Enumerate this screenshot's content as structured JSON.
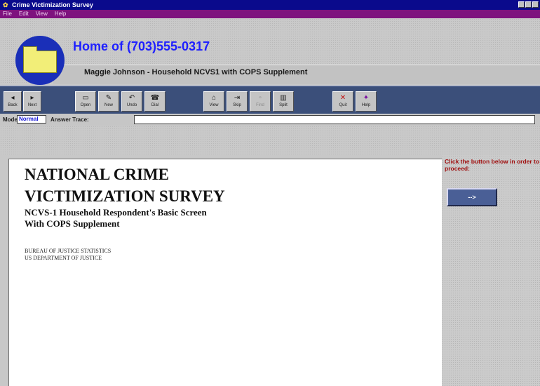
{
  "window": {
    "title": "Crime Victimization Survey"
  },
  "menu": [
    "File",
    "Edit",
    "View",
    "Help"
  ],
  "header": {
    "home_title": "Home of (703)555-0317",
    "subtitle": "Maggie Johnson -  Household NCVS1 with COPS Supplement"
  },
  "toolbar": {
    "buttons": [
      {
        "label": "Back",
        "icon": "back-arrow-icon",
        "glyph": "◂"
      },
      {
        "label": "Next",
        "icon": "next-arrow-icon",
        "glyph": "▸"
      },
      {
        "label": "Open",
        "icon": "open-folder-icon",
        "glyph": "▭"
      },
      {
        "label": "New",
        "icon": "new-case-icon",
        "glyph": "✎"
      },
      {
        "label": "Undo",
        "icon": "undo-icon",
        "glyph": "↶"
      },
      {
        "label": "Dial",
        "icon": "phone-icon",
        "glyph": "☎"
      },
      {
        "label": "View",
        "icon": "house-icon",
        "glyph": "⌂"
      },
      {
        "label": "Skip",
        "icon": "skip-icon",
        "glyph": "⇥"
      },
      {
        "label": "Find",
        "icon": "disabled-icon",
        "glyph": "▫"
      },
      {
        "label": "Split",
        "icon": "split-icon",
        "glyph": "▥"
      },
      {
        "label": "Quit",
        "icon": "quit-x-icon",
        "glyph": "✕"
      },
      {
        "label": "Help",
        "icon": "help-icon",
        "glyph": "✦"
      }
    ]
  },
  "modebar": {
    "mode_label": "Mode:",
    "mode_value": "Normal",
    "trace_label": "Answer Trace:",
    "trace_value": ""
  },
  "document": {
    "title_line1": "NATIONAL CRIME",
    "title_line2": "VICTIMIZATION SURVEY",
    "sub_line1": "NCVS-1 Household Respondent's Basic Screen",
    "sub_line2": "With COPS Supplement",
    "agency_line1": "BUREAU OF JUSTICE STATISTICS",
    "agency_line2": "US DEPARTMENT OF JUSTICE"
  },
  "side": {
    "instruction": "Click the button below in order to proceed:",
    "proceed_label": "-->"
  },
  "colors": {
    "title_bar": "#0a0a8c",
    "menu_bar": "#7e127e",
    "home_title": "#1f20ff",
    "toolbar": "#3b4f7a",
    "instruction": "#a01010"
  }
}
